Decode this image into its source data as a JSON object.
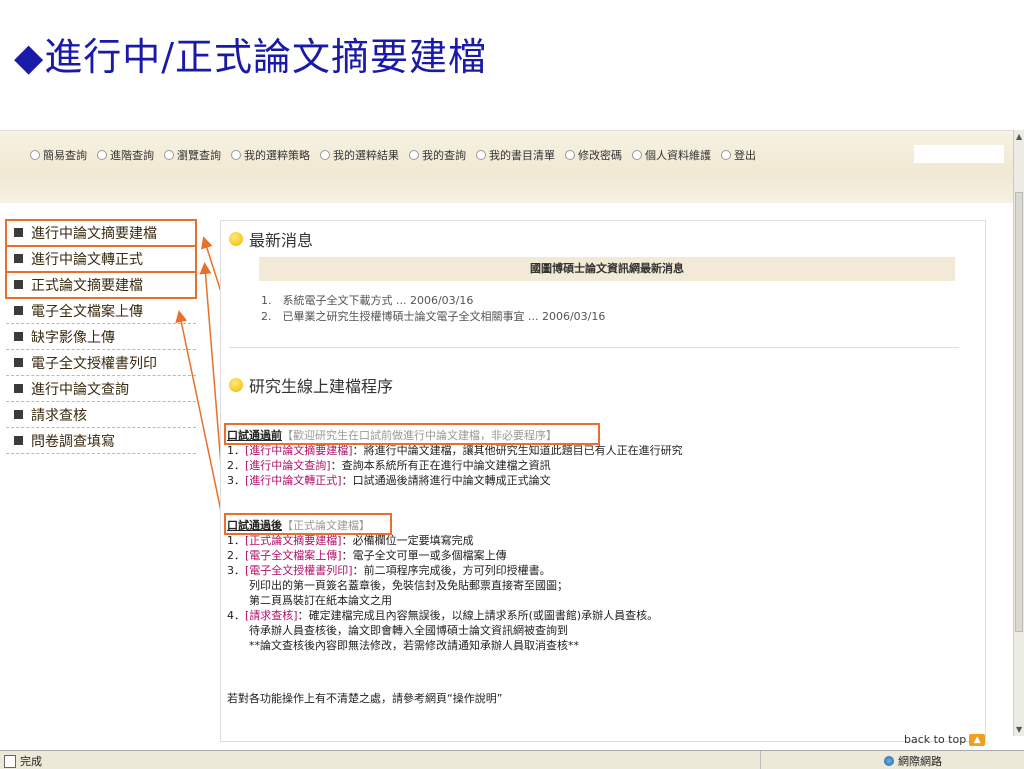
{
  "slide": {
    "title": "◆進行中/正式論文摘要建檔"
  },
  "nav": [
    "簡易查詢",
    "進階查詢",
    "瀏覽查詢",
    "我的選粹策略",
    "我的選粹結果",
    "我的查詢",
    "我的書目清單",
    "修改密碼",
    "個人資料維護",
    "登出"
  ],
  "sidebar": [
    {
      "label": "進行中論文摘要建檔",
      "highlight": true
    },
    {
      "label": "進行中論文轉正式",
      "highlight": true
    },
    {
      "label": "正式論文摘要建檔",
      "highlight": true
    },
    {
      "label": "電子全文檔案上傳",
      "highlight": false
    },
    {
      "label": "缺字影像上傳",
      "highlight": false
    },
    {
      "label": "電子全文授權書列印",
      "highlight": false
    },
    {
      "label": "進行中論文查詢",
      "highlight": false
    },
    {
      "label": "請求查核",
      "highlight": false
    },
    {
      "label": "問卷調查填寫",
      "highlight": false
    }
  ],
  "news": {
    "heading": "最新消息",
    "bar": "國圖博碩士論文資訊網最新消息",
    "items": [
      "1.　系統電子全文下載方式 ... 2006/03/16",
      "2.　已畢業之研究生授權博碩士論文電子全文相關事宜 ... 2006/03/16"
    ]
  },
  "procedure": {
    "heading": "研究生線上建檔程序",
    "before_title": "口試通過前",
    "before_note": "【歡迎研究生在口試前做進行中論文建檔，非必要程序】",
    "before_items": [
      {
        "num": "1．",
        "link": "[進行中論文摘要建檔]",
        "text": "：將進行中論文建檔，讓其他研究生知道此題目已有人正在進行研究"
      },
      {
        "num": "2．",
        "link": "[進行中論文查詢]",
        "text": "：查詢本系統所有正在進行中論文建檔之資訊"
      },
      {
        "num": "3．",
        "link": "[進行中論文轉正式]",
        "text": "：口試通過後請將進行中論文轉成正式論文"
      }
    ],
    "after_title": "口試通過後",
    "after_note": "【正式論文建檔】",
    "after_items": [
      {
        "num": "1．",
        "link": "[正式論文摘要建檔]",
        "text": "：必備欄位一定要填寫完成"
      },
      {
        "num": "2．",
        "link": "[電子全文檔案上傳]",
        "text": "：電子全文可單一或多個檔案上傳"
      },
      {
        "num": "3．",
        "link": "[電子全文授權書列印]",
        "text": "：前二項程序完成後，方可列印授權書。"
      },
      {
        "num": "",
        "link": "",
        "text": "列印出的第一頁簽名蓋章後，免裝信封及免貼郵票直接寄至國圖；"
      },
      {
        "num": "",
        "link": "",
        "text": "第二頁爲裝訂在紙本論文之用"
      },
      {
        "num": "4．",
        "link": "[請求查核]",
        "text": "：確定建檔完成且內容無誤後，以線上請求系所(或圖書館)承辦人員查核。"
      },
      {
        "num": "",
        "link": "",
        "text": "待承辦人員查核後，論文即會轉入全國博碩士論文資訊網被查詢到"
      },
      {
        "num": "",
        "link": "",
        "text": "**論文查核後內容即無法修改，若需修改請通知承辦人員取消查核**"
      }
    ],
    "footer": "若對各功能操作上有不清楚之處，請參考網頁“操作說明”"
  },
  "back_to_top": "back to top",
  "status": {
    "left": "完成",
    "right": "網際網路"
  },
  "colors": {
    "title": "#1a1aa8",
    "highlight": "#e8702a",
    "link": "#b0106a"
  }
}
